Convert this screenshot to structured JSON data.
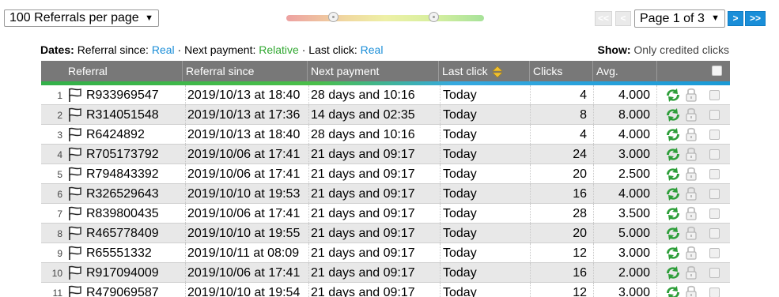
{
  "toolbar": {
    "per_page": "100 Referrals per page",
    "page_label": "Page 1 of 3",
    "first_label": "<<",
    "prev_label": "<",
    "next_label": ">",
    "last_label": ">>"
  },
  "filters": {
    "dates_label": "Dates:",
    "referral_since_label": "Referral since:",
    "referral_since_value": "Real",
    "sep1": "·",
    "next_payment_label": "Next payment:",
    "next_payment_value": "Relative",
    "sep2": "·",
    "last_click_label": "Last click:",
    "last_click_value": "Real",
    "show_label": "Show:",
    "show_value": "Only credited clicks"
  },
  "table": {
    "headers": [
      "Referral",
      "Referral since",
      "Next payment",
      "Last click",
      "Clicks",
      "Avg."
    ],
    "rows": [
      {
        "n": "1",
        "ref": "R933969547",
        "since": "2019/10/13 at 18:40",
        "next": "28 days and 10:16",
        "last": "Today",
        "clicks": "4",
        "avg": "4.000"
      },
      {
        "n": "2",
        "ref": "R314051548",
        "since": "2019/10/13 at 17:36",
        "next": "14 days and 02:35",
        "last": "Today",
        "clicks": "8",
        "avg": "8.000"
      },
      {
        "n": "3",
        "ref": "R6424892",
        "since": "2019/10/13 at 18:40",
        "next": "28 days and 10:16",
        "last": "Today",
        "clicks": "4",
        "avg": "4.000"
      },
      {
        "n": "4",
        "ref": "R705173792",
        "since": "2019/10/06 at 17:41",
        "next": "21 days and 09:17",
        "last": "Today",
        "clicks": "24",
        "avg": "3.000"
      },
      {
        "n": "5",
        "ref": "R794843392",
        "since": "2019/10/06 at 17:41",
        "next": "21 days and 09:17",
        "last": "Today",
        "clicks": "20",
        "avg": "2.500"
      },
      {
        "n": "6",
        "ref": "R326529643",
        "since": "2019/10/10 at 19:53",
        "next": "21 days and 09:17",
        "last": "Today",
        "clicks": "16",
        "avg": "4.000"
      },
      {
        "n": "7",
        "ref": "R839800435",
        "since": "2019/10/06 at 17:41",
        "next": "21 days and 09:17",
        "last": "Today",
        "clicks": "28",
        "avg": "3.500"
      },
      {
        "n": "8",
        "ref": "R465778409",
        "since": "2019/10/10 at 19:55",
        "next": "21 days and 09:17",
        "last": "Today",
        "clicks": "20",
        "avg": "5.000"
      },
      {
        "n": "9",
        "ref": "R65551332",
        "since": "2019/10/11 at 08:09",
        "next": "21 days and 09:17",
        "last": "Today",
        "clicks": "12",
        "avg": "3.000"
      },
      {
        "n": "10",
        "ref": "R917094009",
        "since": "2019/10/06 at 17:41",
        "next": "21 days and 09:17",
        "last": "Today",
        "clicks": "16",
        "avg": "2.000"
      },
      {
        "n": "11",
        "ref": "R479069587",
        "since": "2019/10/10 at 19:54",
        "next": "21 days and 09:17",
        "last": "Today",
        "clicks": "12",
        "avg": "3.000"
      }
    ]
  },
  "colors": {
    "link_blue": "#1a8ed8",
    "relative_green": "#32a832",
    "header_gray": "#787878",
    "refresh_green": "#2e9e3a"
  }
}
